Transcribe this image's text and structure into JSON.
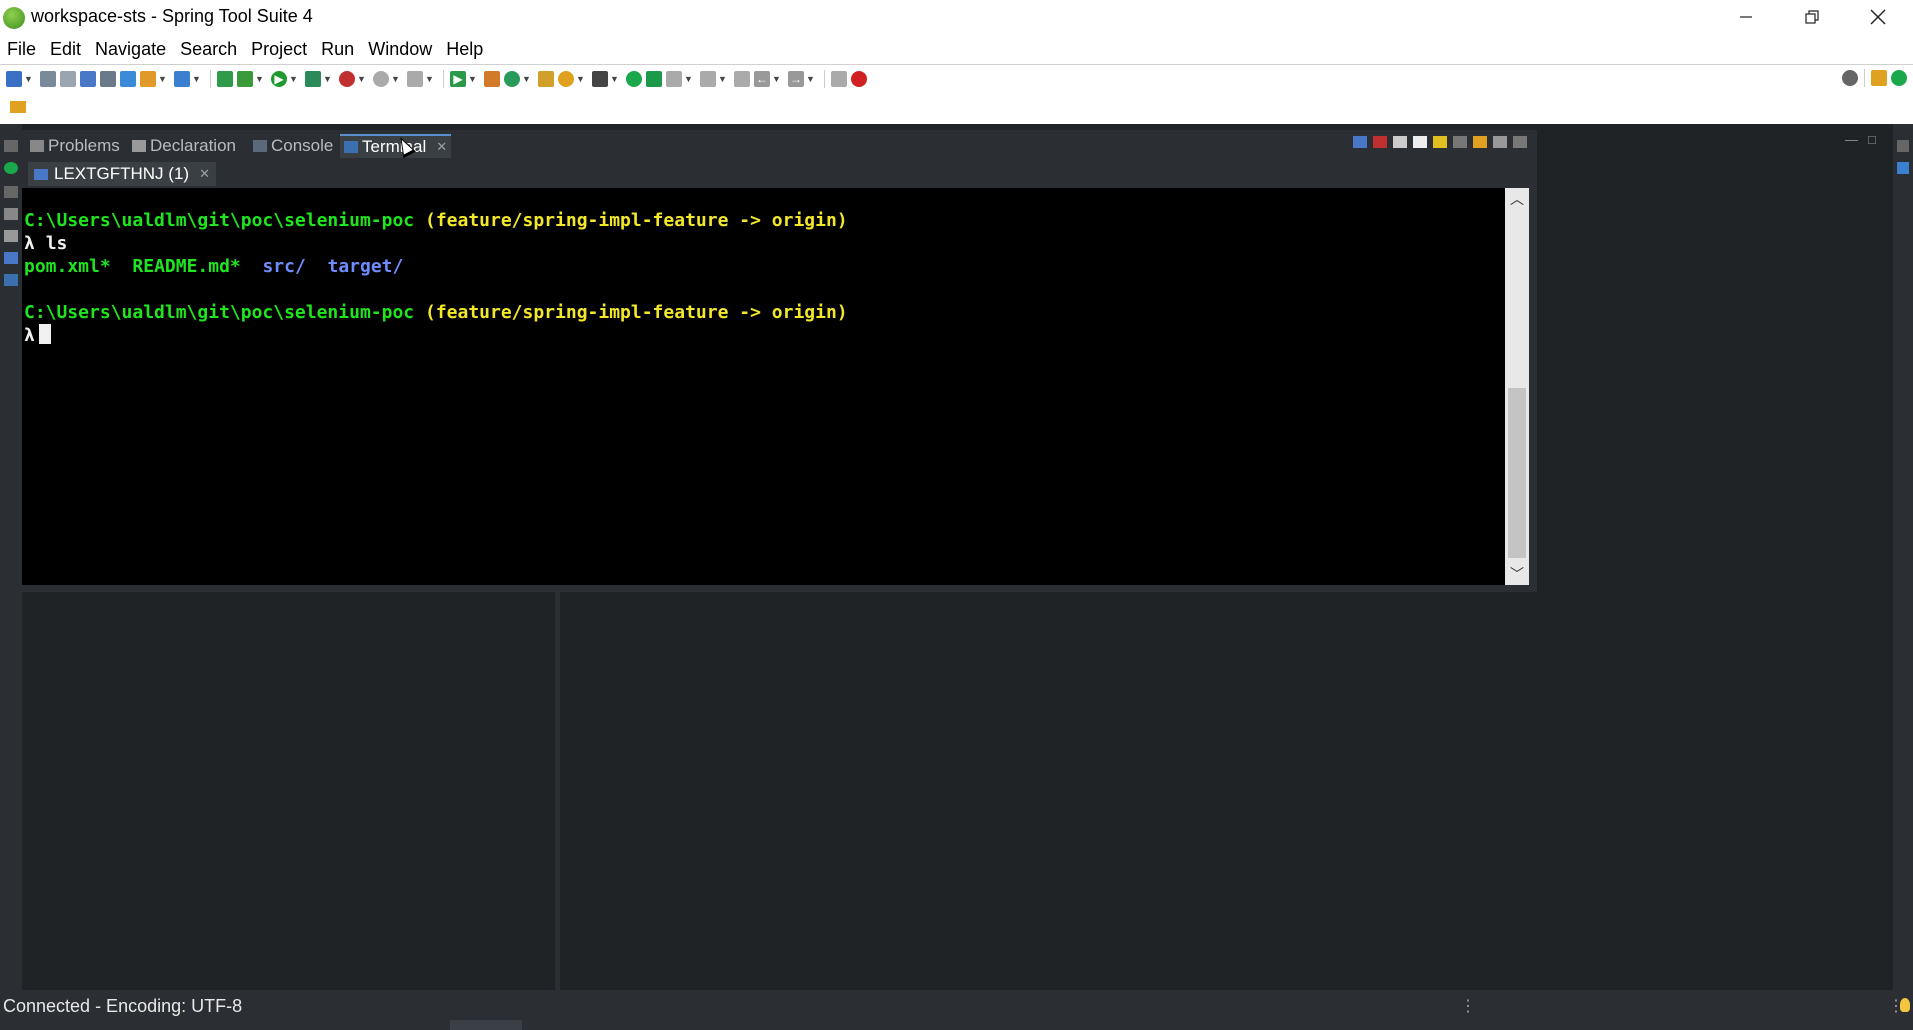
{
  "window": {
    "title": "workspace-sts - Spring Tool Suite 4",
    "minimize_icon": "minimize-icon",
    "restore_icon": "restore-icon",
    "close_icon": "close-icon"
  },
  "menu": {
    "items": [
      "File",
      "Edit",
      "Navigate",
      "Search",
      "Project",
      "Run",
      "Window",
      "Help"
    ]
  },
  "view_tabs": [
    {
      "label": "Problems",
      "icon": "problems-icon"
    },
    {
      "label": "Declaration",
      "icon": "declaration-icon"
    },
    {
      "label": "Console",
      "icon": "console-icon"
    },
    {
      "label": "Terminal",
      "icon": "terminal-icon",
      "active": true
    }
  ],
  "terminal_tab": {
    "label": "LEXTGFTHNJ (1)"
  },
  "terminal": {
    "prompt_path": "C:\\Users\\ualdlm\\git\\poc\\selenium-poc",
    "prompt_branch": "(feature/spring-impl-feature -> origin)",
    "prompt_symbol": "λ",
    "command": "ls",
    "files": {
      "pom": "pom.xml*",
      "readme": "README.md*",
      "src": "src/",
      "target": "target/"
    }
  },
  "status": {
    "text": "Connected - Encoding: UTF-8"
  },
  "colors": {
    "terminal_green": "#1fe51f",
    "terminal_yellow": "#f2e829",
    "terminal_blue": "#6f8cff",
    "ide_dark": "#1f2326"
  }
}
